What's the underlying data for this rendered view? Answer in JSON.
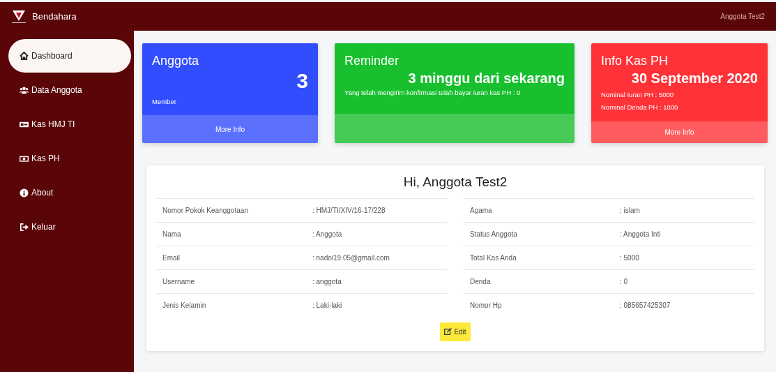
{
  "navbar": {
    "brand": "Bendahara",
    "user": "Anggota Test2"
  },
  "sidebar": {
    "items": [
      {
        "label": "Dashboard",
        "selected": true
      },
      {
        "label": "Data Anggota",
        "selected": false
      },
      {
        "label": "Kas HMJ TI",
        "selected": false
      },
      {
        "label": "Kas PH",
        "selected": false
      },
      {
        "label": "About",
        "selected": false
      },
      {
        "label": "Keluar",
        "selected": false
      }
    ]
  },
  "stat_cards": [
    {
      "kind": "count",
      "color": "#324dfd",
      "title": "Anggota",
      "value": "3",
      "lines": [
        "Member"
      ],
      "footer": "More Info"
    },
    {
      "kind": "headline",
      "color": "#18bf2e",
      "title": "Reminder",
      "value": "3 minggu dari sekarang",
      "lines": [
        "Yang telah mengirim konfirmasi telah bayar iuran kas PH : 0"
      ]
    },
    {
      "kind": "headline",
      "color": "#fe3237",
      "title": "Info Kas PH",
      "value": "30 September 2020",
      "lines": [
        "Nominal Iuran PH : 5000",
        "Nominal Denda PH : 1000"
      ],
      "footer": "More Info"
    }
  ],
  "profile": {
    "title": "Hi, Anggota Test2",
    "left_rows": [
      {
        "label": "Nomor Pokok Keanggotaan",
        "value": ": HMJ/TI/XIV/16-17/228"
      },
      {
        "label": "Nama",
        "value": ": Anggota"
      },
      {
        "label": "Email",
        "value": ": nadoi19.05@gmail.com"
      },
      {
        "label": "Username",
        "value": ": anggota"
      },
      {
        "label": "Jenis Kelamin",
        "value": ": Laki-laki"
      }
    ],
    "right_rows": [
      {
        "label": "Agama",
        "value": ": islam"
      },
      {
        "label": "Status Anggota",
        "value": ": Anggota Inti"
      },
      {
        "label": "Total Kas Anda",
        "value": ": 5000"
      },
      {
        "label": "Denda",
        "value": ": 0"
      },
      {
        "label": "Nomor Hp",
        "value": ": 085657425307"
      }
    ],
    "edit_button": "Edit"
  }
}
